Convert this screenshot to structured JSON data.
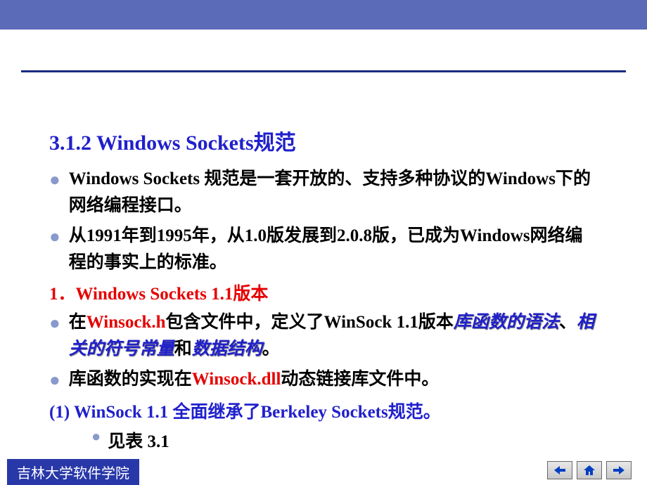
{
  "heading": "3.1.2  Windows Sockets规范",
  "bullets": [
    "Windows Sockets 规范是一套开放的、支持多种协议的Windows下的网络编程接口。",
    "从1991年到1995年，从1.0版发展到2.0.8版，已成为Windows网络编程的事实上的标准。"
  ],
  "numberedHeading": "1．Windows Sockets 1.1版本",
  "bullet3": {
    "prefix": "在",
    "red1": "Winsock.h",
    "mid1": "包含文件中，定义了WinSock 1.1版本",
    "blue1": "库函数的语法",
    "sep1": "、",
    "blue2": "相关的符号常量",
    "sep2": "和",
    "blue3": "数据结构",
    "suffix": "。"
  },
  "bullet4": {
    "prefix": "库函数的实现在",
    "red": "Winsock.dll",
    "suffix": "动态链接库文件中。"
  },
  "subheading": "(1) WinSock 1.1 全面继承了Berkeley Sockets规范。",
  "subBullet": "见表 3.1",
  "footer": "吉林大学软件学院"
}
